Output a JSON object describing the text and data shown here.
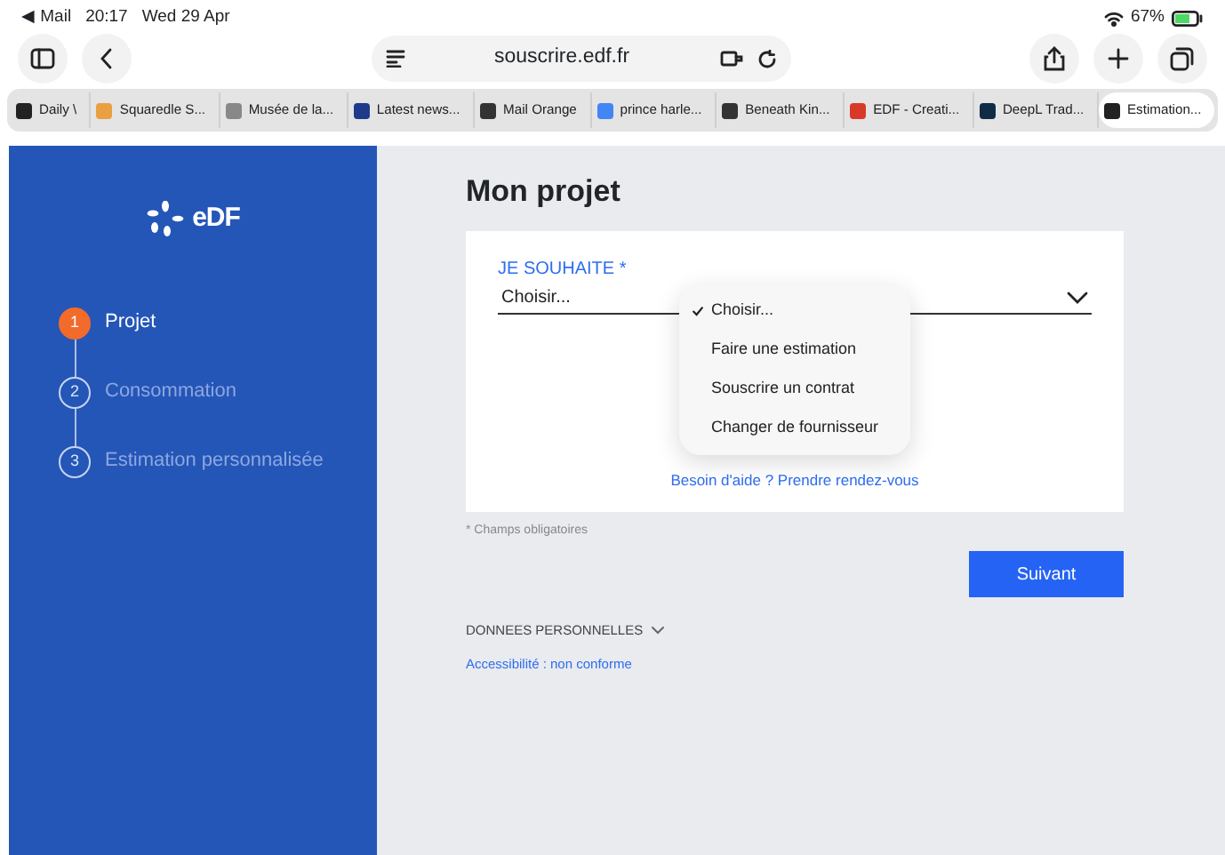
{
  "status_bar": {
    "back_app": "◀ Mail",
    "time": "20:17",
    "date": "Wed 29 Apr",
    "battery": "67%"
  },
  "address_bar": {
    "url": "souscrire.edf.fr"
  },
  "tabs": [
    {
      "label": "Daily \\",
      "selected": false,
      "color": "#222222"
    },
    {
      "label": "Squaredle S...",
      "selected": false,
      "color": "#e8a040"
    },
    {
      "label": "Musée de la...",
      "selected": false,
      "color": "#888888"
    },
    {
      "label": "Latest news...",
      "selected": false,
      "color": "#1d3b8a"
    },
    {
      "label": "Mail Orange",
      "selected": false,
      "color": "#333333"
    },
    {
      "label": "prince harle...",
      "selected": false,
      "color": "#4285f4"
    },
    {
      "label": "Beneath Kin...",
      "selected": false,
      "color": "#333333"
    },
    {
      "label": "EDF - Creati...",
      "selected": false,
      "color": "#d83a2a"
    },
    {
      "label": "DeepL Trad...",
      "selected": false,
      "color": "#0f2b46"
    },
    {
      "label": "Estimation...",
      "selected": true,
      "color": "#222222"
    }
  ],
  "sidebar": {
    "logo": "eDF",
    "steps": [
      {
        "number": "1",
        "label": "Projet",
        "selected": true
      },
      {
        "number": "2",
        "label": "Consommation",
        "selected": false
      },
      {
        "number": "3",
        "label": "Estimation personnalisée",
        "selected": false
      }
    ]
  },
  "main": {
    "title": "Mon projet",
    "field": {
      "label": "JE SOUHAITE *",
      "value": "Choisir..."
    },
    "dropdown": [
      {
        "label": "Choisir...",
        "selected": true
      },
      {
        "label": "Faire une estimation",
        "selected": false
      },
      {
        "label": "Souscrire un contrat",
        "selected": false
      },
      {
        "label": "Changer de fournisseur",
        "selected": false
      }
    ],
    "help_link": "Besoin d'aide ? Prendre rendez-vous",
    "required_note": "* Champs obligatoires",
    "next_button": "Suivant",
    "footer_section": "DONNEES PERSONNELLES",
    "accessibility_link": "Accessibilité : non conforme"
  }
}
